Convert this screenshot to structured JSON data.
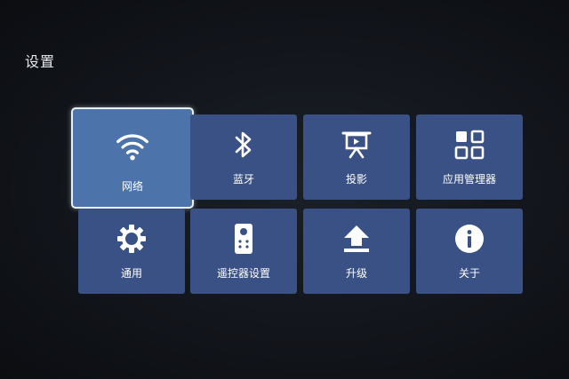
{
  "header": {
    "title": "设置"
  },
  "tiles": [
    {
      "label": "网络",
      "icon": "wifi-icon",
      "focused": true
    },
    {
      "label": "蓝牙",
      "icon": "bluetooth-icon"
    },
    {
      "label": "投影",
      "icon": "projection-screen-icon"
    },
    {
      "label": "应用管理器",
      "icon": "app-grid-icon"
    },
    {
      "label": "通用",
      "icon": "gear-icon"
    },
    {
      "label": "遥控器设置",
      "icon": "remote-control-icon"
    },
    {
      "label": "升级",
      "icon": "upload-arrow-icon"
    },
    {
      "label": "关于",
      "icon": "info-icon"
    }
  ],
  "colors": {
    "tile": "#3a5185",
    "tile_focused": "#4c74ab",
    "focus_border": "#e9f0f5"
  }
}
